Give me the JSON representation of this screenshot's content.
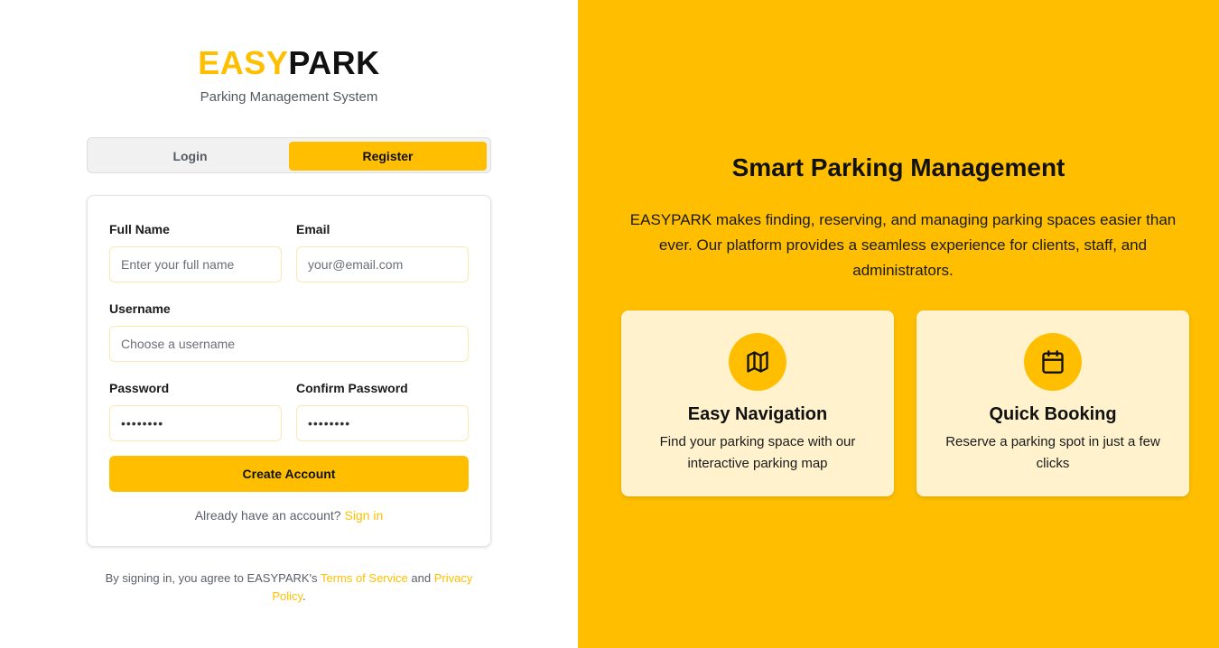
{
  "brand": {
    "part1": "EASY",
    "part2": "PARK",
    "subtitle": "Parking Management System"
  },
  "tabs": [
    {
      "label": "Login",
      "active": false
    },
    {
      "label": "Register",
      "active": true
    }
  ],
  "form": {
    "full_name": {
      "label": "Full Name",
      "placeholder": "Enter your full name",
      "value": ""
    },
    "email": {
      "label": "Email",
      "placeholder": "your@email.com",
      "value": ""
    },
    "username": {
      "label": "Username",
      "placeholder": "Choose a username",
      "value": ""
    },
    "password": {
      "label": "Password",
      "value": "••••••••"
    },
    "confirm_password": {
      "label": "Confirm Password",
      "value": "••••••••"
    },
    "submit_label": "Create Account",
    "have_account_text": "Already have an account?",
    "sign_in_link": "Sign in"
  },
  "terms": {
    "prefix": "By signing in, you agree to EASYPARK's",
    "tos_link": "Terms of Service",
    "and": "and",
    "privacy_link": "Privacy Policy",
    "suffix": "."
  },
  "hero": {
    "title": "Smart Parking Management",
    "description": "EASYPARK makes finding, reserving, and managing parking spaces easier than ever. Our platform provides a seamless experience for clients, staff, and administrators."
  },
  "features": [
    {
      "icon": "map-icon",
      "title": "Easy Navigation",
      "description": "Find your parking space with our interactive parking map"
    },
    {
      "icon": "calendar-icon",
      "title": "Quick Booking",
      "description": "Reserve a parking spot in just a few clicks"
    }
  ],
  "colors": {
    "accent": "#ffbf00",
    "accent_light": "#fff2cc",
    "text": "#111111",
    "muted": "#5b6068"
  }
}
